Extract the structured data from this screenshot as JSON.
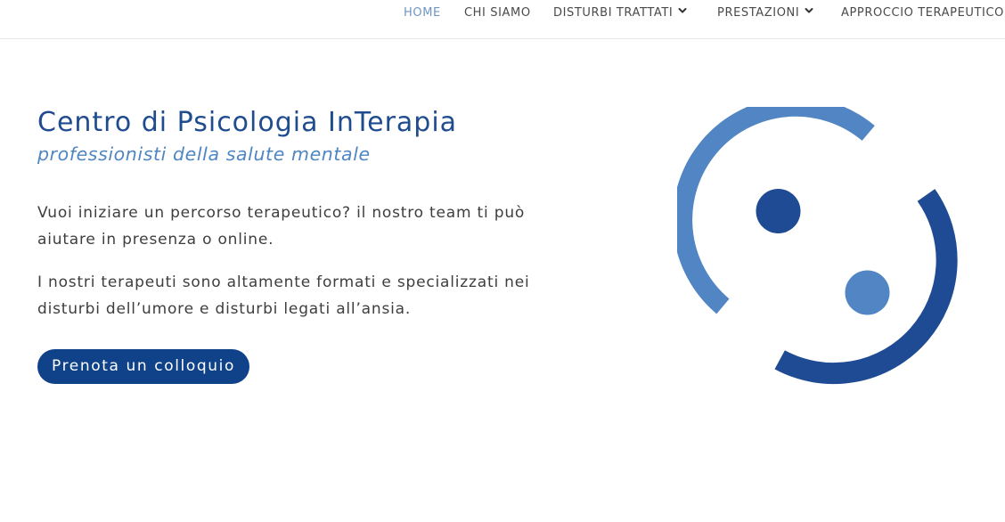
{
  "nav": {
    "items": [
      {
        "label": "HOME",
        "active": true,
        "has_dropdown": false
      },
      {
        "label": "CHI SIAMO",
        "active": false,
        "has_dropdown": false
      },
      {
        "label": "DISTURBI TRATTATI",
        "active": false,
        "has_dropdown": true
      },
      {
        "label": "PRESTAZIONI",
        "active": false,
        "has_dropdown": true
      },
      {
        "label": "APPROCCIO TERAPEUTICO",
        "active": false,
        "has_dropdown": false
      }
    ]
  },
  "hero": {
    "title": "Centro di Psicologia InTerapia",
    "subtitle": "professionisti della salute mentale",
    "paragraph_1": "Vuoi iniziare un percorso terapeutico? il nostro team ti può aiutare in presenza o online.",
    "paragraph_2": "I nostri terapeuti sono altamente formati e specializzati nei disturbi dell’umore e disturbi legati all’ansia.",
    "cta_label": "Prenota un colloquio"
  },
  "colors": {
    "nav_active": "#6f95c4",
    "nav_text": "#4a4a4a",
    "title": "#1f4c8f",
    "subtitle": "#4f86c2",
    "button_bg": "#0f4289",
    "logo_light": "#5185c3",
    "logo_dark": "#1f4b94"
  },
  "icons": {
    "logo": "two-arcs-two-dots-logo",
    "dropdown": "chevron-down-icon"
  }
}
